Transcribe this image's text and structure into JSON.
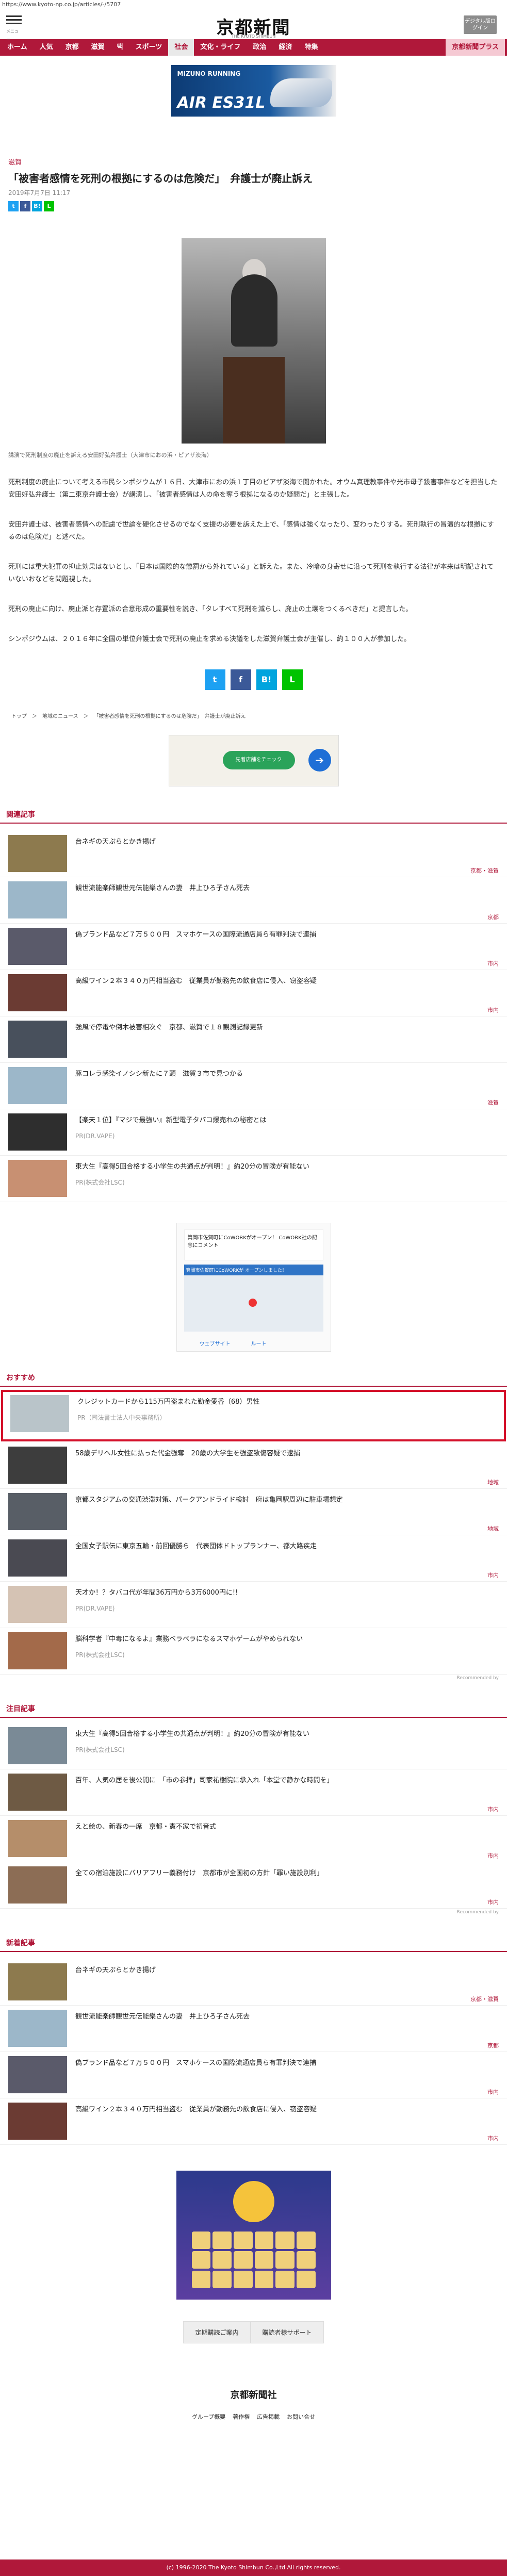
{
  "url": "https://www.kyoto-np.co.jp/articles/-/5707",
  "header": {
    "menu_label": "メニュー",
    "logo": "京都新聞",
    "logo_sub": "THE KYOTO SHIMBUN",
    "digital_button": "デジタル版ログイン"
  },
  "nav": [
    "ホーム",
    "人気",
    "京都",
    "滋賀",
    "택",
    "スポーツ",
    "社会",
    "文化・ライフ",
    "政治",
    "経済",
    "特集"
  ],
  "nav_subscribe": "京都新聞プラス",
  "ad_banner": {
    "t1": "MIZUNO RUNNING",
    "t2": "AIR ES31L"
  },
  "article": {
    "section": "滋賀",
    "title": "「被害者感情を死刑の根拠にするのは危険だ」　弁護士が廃止訴え",
    "date": "2019年7月7日 11:17",
    "caption": "講演で死刑制度の廃止を訴える安田好弘弁護士（大津市におの浜・ピアザ淡海）",
    "paragraphs": [
      "死刑制度の廃止について考える市民シンポジウムが１６日、大津市におの浜１丁目のピアザ淡海で開かれた。オウム真理教事件や光市母子殺害事件などを担当した安田好弘弁護士（第二東京弁護士会）が講演し、「被害者感情は人の命を奪う根拠になるのか疑問だ」と主張した。",
      "安田弁護士は、被害者感情への配慮で世論を硬化させるのでなく支援の必要を訴えた上で、「感情は強くなったり、変わったりする。死刑執行の冒瀆的な根拠にするのは危険だ」と述べた。",
      "死刑には重大犯罪の抑止効果はないとし、「日本は国際的な懲罰から外れている」と訴えた。また、冷暗の身寄せに沿って死刑を執行する法律が本来は明記されていないおなどを問題視した。",
      "死刑の廃止に向け、廃止派と存置派の合意形成の重要性を説き、「タレすべて死刑を減らし、廃止の土壌をつくるべきだ」と提言した。",
      "シンポジウムは、２０１６年に全国の単位弁護士会で死刑の廃止を求める決議をした滋賀弁護士会が主催し、約１００人が参加した。"
    ]
  },
  "share": {
    "tw": "t",
    "fb": "f",
    "hb": "B!",
    "line": "L"
  },
  "breadcrumb": [
    "トップ",
    "＞",
    "地域のニュース",
    "＞",
    "「被害者感情を死刑の根拠にするのは危険だ」　弁護士が廃止訴え"
  ],
  "map_ad": {
    "pill": "先着店舗をチェック",
    "nav": "➔"
  },
  "related": {
    "heading": "関連記事",
    "items": [
      {
        "title": "台ネギの天ぷらとかき揚げ",
        "cat": "京都・滋賀"
      },
      {
        "title": "観世流能楽師観世元伝能樂さんの妻　井上ひろ子さん死去",
        "cat": "京都"
      },
      {
        "title": "偽ブランド品など７万５００円　スマホケースの国際流通店員ら有罪判決で連捕",
        "cat": "市内"
      },
      {
        "title": "高級ワイン２本３４０万円相当盗む　従業員が勤務先の飲食店に侵入、窃盗容疑",
        "cat": "市内"
      },
      {
        "title": "強風で停電や倒木被害相次ぐ　京都、滋賀で１８観測記録更新",
        "cat": ""
      },
      {
        "title": "豚コレラ感染イノシシ新たに７頭　滋賀３市で見つかる",
        "cat": "滋賀"
      },
      {
        "title": "【楽天１位】『マジで最強い』新型電子タバコ爆売れの秘密とは",
        "pr": "PR(DR.VAPE)"
      },
      {
        "title": "東大生『高得5回合格する小学生の共通点が判明！』約20分の冒険が有能ない",
        "pr": "PR(株式会社LSC)"
      }
    ]
  },
  "ad_square": {
    "top": "箕岡市佐賀町にCoWORKがオープン！ CoWORK社の記念にコメント",
    "banner": "箕岡市佐賀町にCoWORKが オープンしました！",
    "b1": "ウェブサイト",
    "b2": "ルート"
  },
  "recommended": {
    "heading": "おすすめ",
    "items": [
      {
        "title": "クレジットカードから115万円盗まれた勤金愛香（68）男性",
        "pr": "PR（司法書士法人中央事務所）",
        "highlight": true
      },
      {
        "title": "58歳デリヘル女性に払った代金強奪　20歳の大学生を強盗致傷容疑で逮捕",
        "cat": "地域"
      },
      {
        "title": "京都スタジアムの交通渋滞対策、パークアンドライド検討　府は亀岡駅周辺に駐車場想定",
        "cat": "地域"
      },
      {
        "title": "全国女子駅伝に東京五輪・前回優勝ら　代表団体ドトップランナー、都大路疾走",
        "cat": "市内"
      },
      {
        "title": "天才か！？タバコ代が年間36万円から3万6000円に!!",
        "pr": "PR(DR.VAPE)"
      },
      {
        "title": "脳科学者『中毒になるよ』業務ベラベラになるスマホゲームがやめられない",
        "pr": "PR(株式会社LSC)"
      }
    ],
    "powered": "Recommended by"
  },
  "featured": {
    "heading": "注目記事",
    "items": [
      {
        "title": "東大生『高得5回合格する小学生の共通点が判明！』約20分の冒険が有能ない",
        "pr": "PR(株式会社LSC)"
      },
      {
        "title": "百年、人気の居を後公開に　「市の参拝」司家祐樹院に承入れ「本堂で静かな時間を」",
        "cat": "市内"
      },
      {
        "title": "えと絵の、新春の一席　京都・憲不家で初音式",
        "cat": "市内"
      },
      {
        "title": "全ての宿泊施設にバリアフリー義務付け　京都市が全国初の方針「罪い施設別利」",
        "cat": "市内"
      }
    ],
    "powered": "Recommended by"
  },
  "latest": {
    "heading": "新着記事",
    "items": [
      {
        "title": "台ネギの天ぷらとかき揚げ",
        "cat": "京都・滋賀"
      },
      {
        "title": "観世流能楽師観世元伝能樂さんの妻　井上ひろ子さん死去",
        "cat": "京都"
      },
      {
        "title": "偽ブランド品など７万５００円　スマホケースの国際流通店員ら有罪判決で連捕",
        "cat": "市内"
      },
      {
        "title": "高級ワイン２本３４０万円相当盗む　従業員が勤務先の飲食店に侵入、窃盗容疑",
        "cat": "市内"
      }
    ]
  },
  "footer": {
    "btn1": "定期購読ご案内",
    "btn2": "購読者様サポート",
    "logo": "京都新聞社",
    "links": [
      "グループ概要",
      "著作権",
      "広告掲載",
      "お問い合せ"
    ],
    "copyright": "(c) 1996-2020 The Kyoto Shimbun Co.,Ltd All rights reserved."
  }
}
